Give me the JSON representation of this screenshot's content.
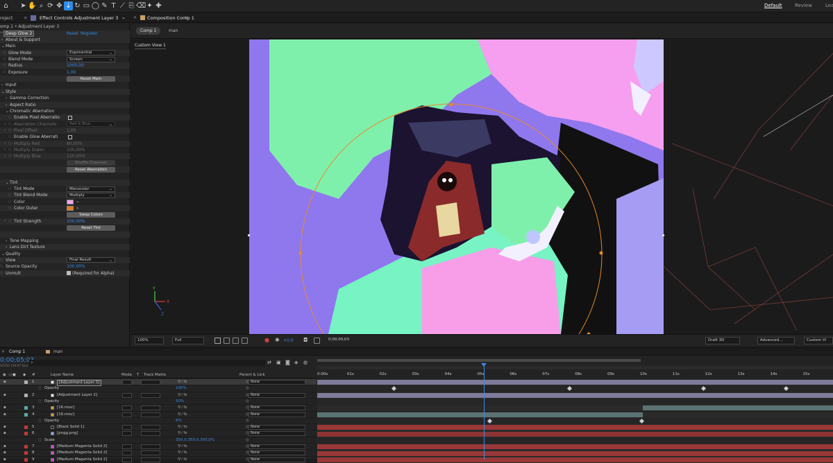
{
  "toolbar": {
    "tools": [
      "home-icon",
      "selection-icon",
      "hand-icon",
      "zoom-icon",
      "orbit-icon",
      "pan-icon",
      "dolly-icon",
      "rotate-icon",
      "camera-icon",
      "mask-icon",
      "pen-icon",
      "type-icon",
      "brush-icon",
      "clone-icon",
      "eraser-icon",
      "roto-icon",
      "puppet-icon"
    ],
    "workspaces": [
      "Default",
      "Review",
      "Lea"
    ]
  },
  "left": {
    "tab_project": "roject",
    "tab_effect": "Effect Controls Adjustment Layer 3",
    "subtitle": "omp 1 • Adjustment Layer 3",
    "effect_name": "Deep Glow 2",
    "reset": "Reset",
    "register": "Register",
    "rows": [
      {
        "type": "head",
        "label": "About & Support",
        "indent": 2
      },
      {
        "type": "head",
        "label": "Main",
        "indent": 2,
        "open": true
      },
      {
        "type": "dd",
        "label": "Glow Mode",
        "value": "Exponential",
        "indent": 12
      },
      {
        "type": "dd",
        "label": "Blend Mode",
        "value": "Screen",
        "indent": 12
      },
      {
        "type": "val",
        "label": "Radius",
        "value": "1000,00",
        "indent": 12,
        "tw": true
      },
      {
        "type": "val",
        "label": "Exposure",
        "value": "1,00",
        "indent": 12,
        "tw": true
      },
      {
        "type": "btn",
        "label": "Reset Main"
      },
      {
        "type": "head",
        "label": "Input",
        "indent": 2
      },
      {
        "type": "head",
        "label": "Style",
        "indent": 2,
        "open": true
      },
      {
        "type": "head",
        "label": "Gamma Correction",
        "indent": 8
      },
      {
        "type": "head",
        "label": "Aspect Ratio",
        "indent": 8
      },
      {
        "type": "head",
        "label": "Chromatic Aberration",
        "indent": 8,
        "open": true
      },
      {
        "type": "chk",
        "label": "Enable Pixel Aberratio",
        "indent": 20
      },
      {
        "type": "dd",
        "label": "Aberration Channels",
        "value": "Red & Blue",
        "indent": 20,
        "dis": true
      },
      {
        "type": "val",
        "label": "Pixel Offset",
        "value": "1,00",
        "indent": 20,
        "dis": true
      },
      {
        "type": "chk",
        "label": "Enable Glow Aberrati",
        "indent": 20
      },
      {
        "type": "val",
        "label": "Multiply Red",
        "value": "80,00%",
        "indent": 20,
        "dis": true
      },
      {
        "type": "val",
        "label": "Multiply Green",
        "value": "100,00%",
        "indent": 20,
        "dis": true
      },
      {
        "type": "val",
        "label": "Multiply Blue",
        "value": "120,00%",
        "indent": 20,
        "dis": true
      },
      {
        "type": "btn",
        "label": "Shuffle Channels",
        "dis": true
      },
      {
        "type": "btn",
        "label": "Reset Aberration"
      },
      {
        "type": "blank"
      },
      {
        "type": "head",
        "label": "Tint",
        "indent": 8,
        "open": true
      },
      {
        "type": "dd",
        "label": "Tint Mode",
        "value": "Monocolor",
        "indent": 20
      },
      {
        "type": "dd",
        "label": "Tint Blend Mode",
        "value": "Multiply",
        "indent": 20
      },
      {
        "type": "color",
        "label": "Color",
        "value": "#f4a6e8",
        "indent": 20
      },
      {
        "type": "color",
        "label": "Color Outer",
        "value": "#e87a1c",
        "indent": 20
      },
      {
        "type": "btn",
        "label": "Swap Colors"
      },
      {
        "type": "val",
        "label": "Tint Strength",
        "value": "100,00%",
        "indent": 20,
        "tw": true
      },
      {
        "type": "btn",
        "label": "Reset Tint"
      },
      {
        "type": "blank"
      },
      {
        "type": "head",
        "label": "Tone Mapping",
        "indent": 8
      },
      {
        "type": "head",
        "label": "Lens Dirt Texture",
        "indent": 8
      },
      {
        "type": "head",
        "label": "Quality",
        "indent": 2,
        "open": true
      },
      {
        "type": "dd",
        "label": "View",
        "value": "Final Result",
        "indent": 8
      },
      {
        "type": "val",
        "label": "Source Opacity",
        "value": "100,00%",
        "indent": 8,
        "tw": true
      },
      {
        "type": "chk",
        "label": "Unmult",
        "value": "(Required for Alpha)",
        "indent": 8,
        "checked": true
      }
    ]
  },
  "comp": {
    "tab_title": "Composition Comp 1",
    "nav_comp": "Comp 1",
    "nav_man": "man",
    "view_label": "Custom View 1",
    "zoom": "100%",
    "resolution": "Full",
    "timecode": "0;00;05;03",
    "exposure": "+0,0",
    "renderer": "Draft 3D",
    "advanced": "Advanced...",
    "custom_view": "Custom Vi"
  },
  "timeline": {
    "tab_comp": "Comp 1",
    "tab_man": "man",
    "timecode": "0;00;05;03",
    "fps": "00153 (29.97 fps)",
    "cols": {
      "num": "#",
      "layer": "Layer Name",
      "mode": "Mode",
      "t": "T",
      "track": "Track Matte",
      "parent": "Parent & Link"
    },
    "ticks": [
      "0:00s",
      "01s",
      "02s",
      "03s",
      "04s",
      "05s",
      "06s",
      "07s",
      "08s",
      "09s",
      "10s",
      "11s",
      "12s",
      "13s",
      "14s",
      "15s"
    ],
    "rows": [
      {
        "num": "1",
        "name": "[Adjustment Layer 3]",
        "mode": true,
        "parent": "None",
        "label": "#b0b0b0",
        "sel": true,
        "bar": "#7d7a9a",
        "bstart": 0,
        "bend": 1,
        "icon": "adj"
      },
      {
        "prop": "Opacity",
        "value": "100%",
        "kf": [
          0.15,
          0.49,
          0.75,
          0.91
        ]
      },
      {
        "num": "2",
        "name": "[Adjustment Layer 2]",
        "mode": true,
        "parent": "None",
        "label": "#b0b0b0",
        "bar": "#7d7a9a",
        "bstart": 0,
        "bend": 1,
        "icon": "adj"
      },
      {
        "prop": "Opacity",
        "value": "50%"
      },
      {
        "num": "3",
        "name": "[16.mov]",
        "mode": true,
        "parent": "None",
        "label": "#5fa8a8",
        "bar": "#5c7373",
        "bstart": 0.631,
        "bend": 1,
        "icon": "mov"
      },
      {
        "num": "4",
        "name": "[16.mov]",
        "mode": true,
        "parent": "None",
        "label": "#5fa8a8",
        "bar": "#5c7373",
        "bstart": 0,
        "bend": 0.631,
        "icon": "mov"
      },
      {
        "prop": "Opacity",
        "value": "9%",
        "kf": [
          0.335,
          0.63
        ]
      },
      {
        "num": "5",
        "name": "[Black Solid 1]",
        "mode": true,
        "parent": "None",
        "label": "#c03a3a",
        "bar": "#9a3838",
        "bstart": 0,
        "bend": 1,
        "icon": "solid"
      },
      {
        "num": "6",
        "name": "[pngg.png]",
        "mode": true,
        "parent": "None",
        "label": "#c03a3a",
        "bar": "#8e3434",
        "bstart": 0,
        "bend": 1,
        "icon": "png"
      },
      {
        "prop": "Scale",
        "value": "350,0,350,0,350,0%"
      },
      {
        "num": "7",
        "name": "[Medium Magenta Solid 2]",
        "mode": true,
        "parent": "None",
        "label": "#c03a3a",
        "bar": "#9a3838",
        "bstart": 0,
        "bend": 1,
        "icon": "mag"
      },
      {
        "num": "8",
        "name": "[Medium Magenta Solid 2]",
        "mode": true,
        "parent": "None",
        "label": "#c03a3a",
        "bar": "#9a3838",
        "bstart": 0,
        "bend": 1,
        "icon": "mag"
      },
      {
        "num": "9",
        "name": "[Medium Magenta Solid 2]",
        "mode": true,
        "parent": "None",
        "label": "#c03a3a",
        "bar": "#9a3838",
        "bstart": 0,
        "bend": 1,
        "icon": "mag"
      }
    ]
  }
}
